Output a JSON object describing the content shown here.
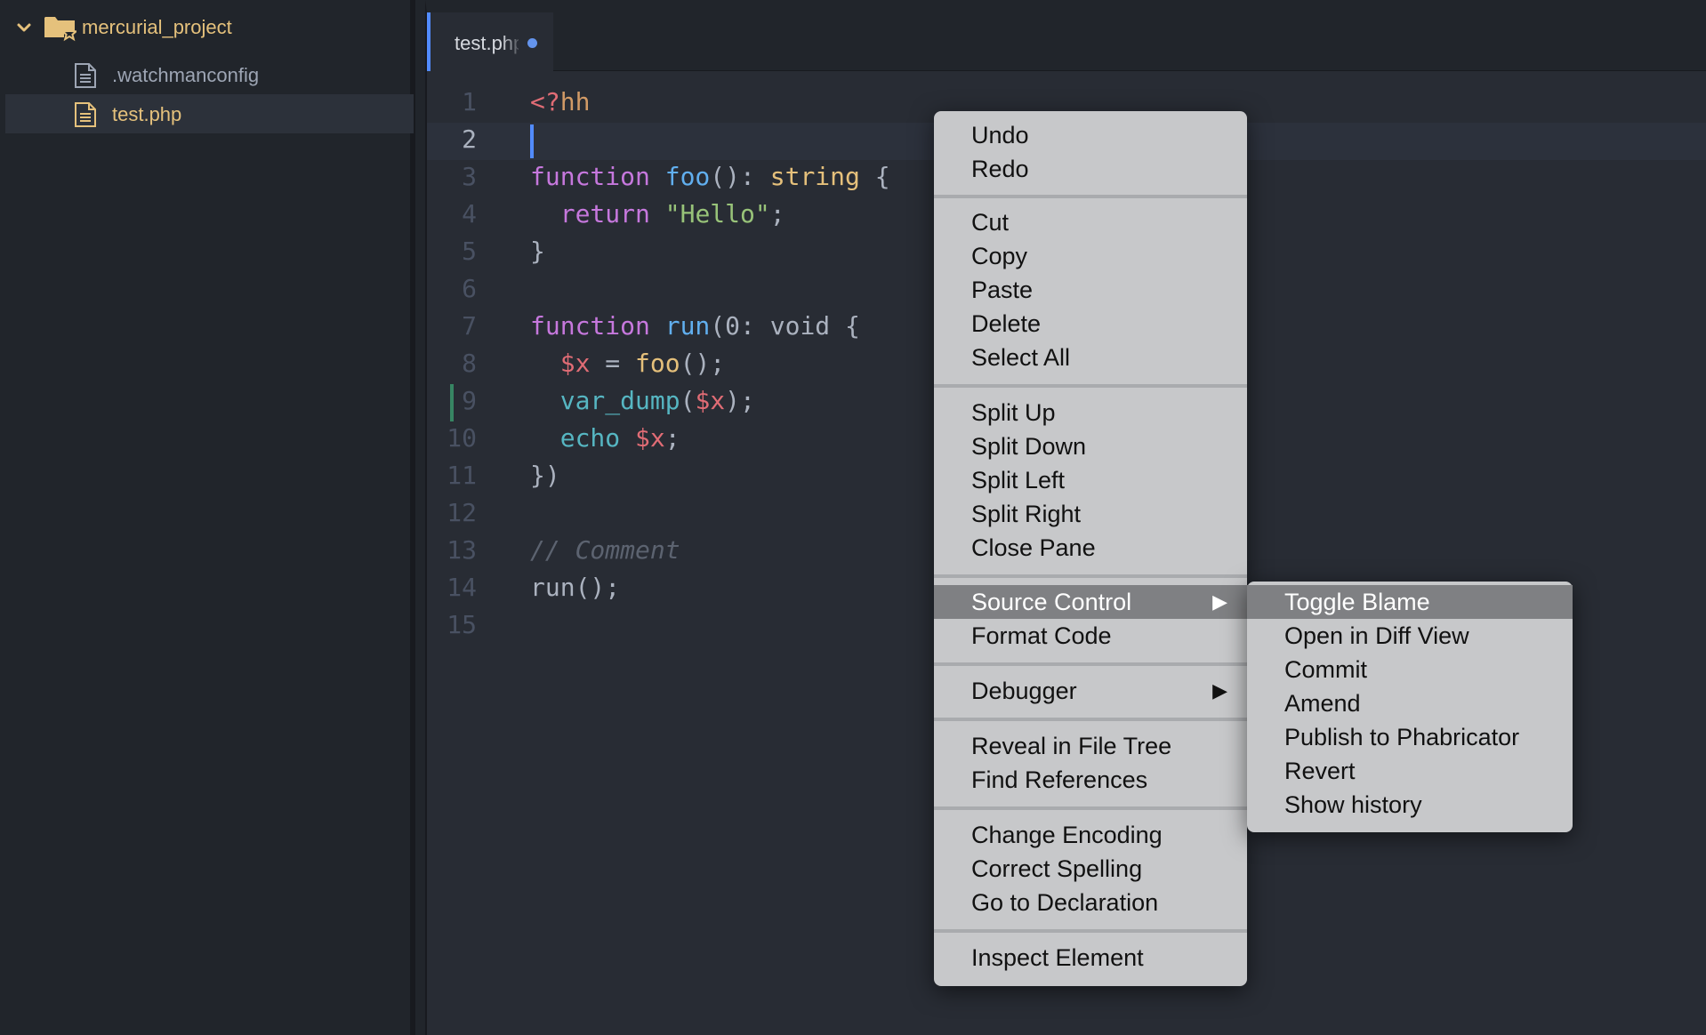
{
  "file_tree": {
    "root": "mercurial_project",
    "files": [
      {
        "name": ".watchmanconfig",
        "color": "#9da5b4",
        "selected": false
      },
      {
        "name": "test.php",
        "color": "#e5c17c",
        "selected": true
      }
    ]
  },
  "editor": {
    "tab_title": "test.php",
    "tab_modified_color": "#6494ed",
    "line_numbers": [
      "1",
      "2",
      "3",
      "4",
      "5",
      "6",
      "7",
      "8",
      "9",
      "10",
      "11",
      "12",
      "13",
      "14",
      "15"
    ],
    "code": {
      "l1_open": "<?",
      "l1_hh": "hh",
      "l3_kw": "function",
      "l3_name": "foo",
      "l3_punc": "(): ",
      "l3_type": "string",
      "l3_brace": " {",
      "l4_kw": "return",
      "l4_str": "\"Hello\"",
      "l4_end": ";",
      "l5": "}",
      "l7_kw": "function",
      "l7_name": "run",
      "l7_rest": "(0: void {",
      "l8_var": "$x",
      "l8_eq": " = ",
      "l8_fn": "foo",
      "l8_end": "();",
      "l9_fn": "var_dump",
      "l9_open": "(",
      "l9_var": "$x",
      "l9_end": ");",
      "l10_kw": "echo",
      "l10_var": "$x",
      "l10_end": ";",
      "l11": "})",
      "l13": "// Comment",
      "l14": "run();"
    }
  },
  "context_menu": {
    "items": {
      "undo": "Undo",
      "redo": "Redo",
      "cut": "Cut",
      "copy": "Copy",
      "paste": "Paste",
      "delete": "Delete",
      "select_all": "Select All",
      "split_up": "Split Up",
      "split_down": "Split Down",
      "split_left": "Split Left",
      "split_right": "Split Right",
      "close_pane": "Close Pane",
      "source_control": "Source Control",
      "format_code": "Format Code",
      "debugger": "Debugger",
      "reveal": "Reveal in File Tree",
      "find_refs": "Find References",
      "change_encoding": "Change Encoding",
      "correct_spelling": "Correct Spelling",
      "goto_decl": "Go to Declaration",
      "inspect": "Inspect Element"
    },
    "submenu_arrow": "▶"
  },
  "source_control_submenu": {
    "items": {
      "toggle_blame": "Toggle Blame",
      "diff_view": "Open in Diff View",
      "commit": "Commit",
      "amend": "Amend",
      "publish": "Publish to Phabricator",
      "revert": "Revert",
      "history": "Show history"
    }
  }
}
